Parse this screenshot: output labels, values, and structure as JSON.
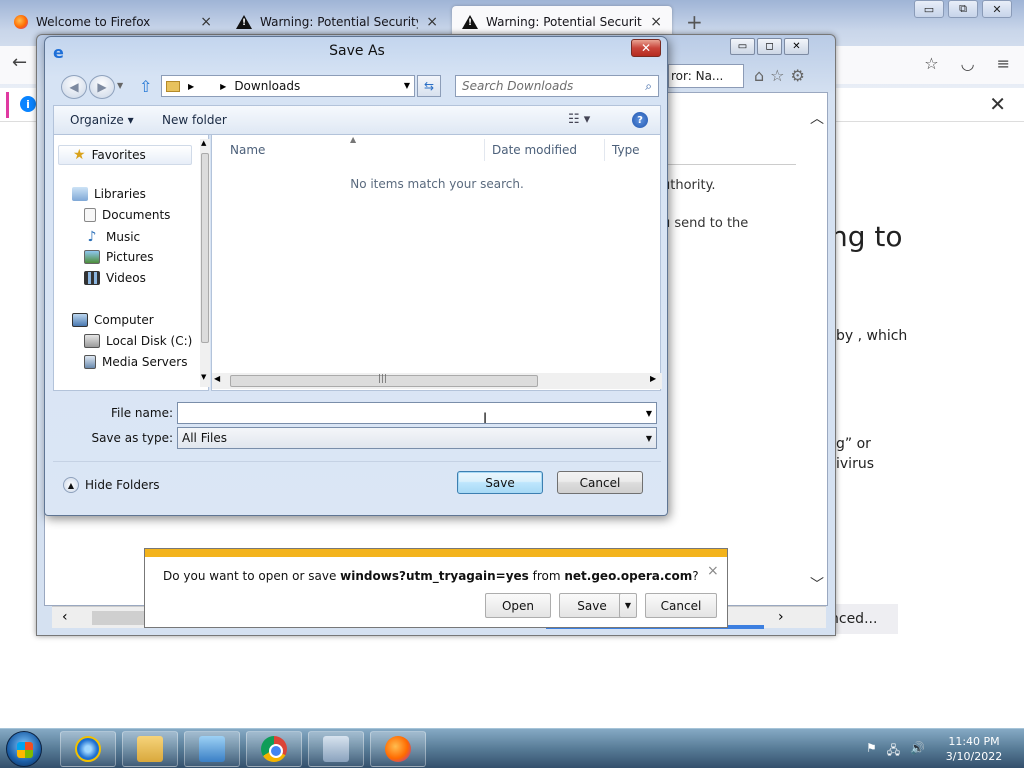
{
  "firefox": {
    "tabs": [
      {
        "label": "Welcome to Firefox"
      },
      {
        "label": "Warning: Potential Security Risk"
      },
      {
        "label": "Warning: Potential Security Risk"
      }
    ],
    "new_tab_glyph": "+",
    "close_glyph": "×",
    "nav_back_glyph": "←",
    "window_controls": [
      "▭",
      "⧉",
      "✕"
    ],
    "info_glyph": "i",
    "notif_close_glyph": "✕",
    "page_heading_fragment": "ng to",
    "page_text_fragment_1": "by , which",
    "page_text_fragment_2": "g” or",
    "page_text_fragment_3": "ivirus",
    "advanced_button_fragment": "nced..."
  },
  "ie_window": {
    "window_controls": [
      "▭",
      "◻",
      "✕"
    ],
    "address_fragment": "ror: Na...",
    "page_text_fragment_1": "uthority.",
    "page_text_fragment_2": "u send to the"
  },
  "save_as": {
    "title": "Save As",
    "close_glyph": "✕",
    "address": {
      "location": "Downloads"
    },
    "search": {
      "placeholder": "Search Downloads"
    },
    "toolbar": {
      "organize_label": "Organize ▾",
      "new_folder_label": "New folder",
      "help_glyph": "?"
    },
    "nav_pane": {
      "favorites": "Favorites",
      "libraries": "Libraries",
      "documents": "Documents",
      "music": "Music",
      "pictures": "Pictures",
      "videos": "Videos",
      "computer": "Computer",
      "local_disk": "Local Disk (C:)",
      "media_servers": "Media Servers"
    },
    "columns": {
      "name": "Name",
      "date_modified": "Date modified",
      "type": "Type"
    },
    "empty_message": "No items match your search.",
    "file_name_label": "File name:",
    "file_name_value": "",
    "save_as_type_label": "Save as type:",
    "save_as_type_value": "All Files",
    "hide_folders_label": "Hide Folders",
    "save_button": "Save",
    "cancel_button": "Cancel"
  },
  "notification": {
    "prefix": "Do you want to open or save ",
    "file": "windows?utm_tryagain=yes",
    "middle": " from ",
    "source": "net.geo.opera.com",
    "suffix": "?",
    "open_button": "Open",
    "save_button": "Save",
    "cancel_button": "Cancel",
    "close_glyph": "×"
  },
  "taskbar": {
    "clock_time": "11:40 PM",
    "clock_date": "3/10/2022"
  },
  "colors": {
    "accent_blue": "#3c7fb1",
    "notification_bar": "#f3b31c",
    "close_red": "#c9453a"
  }
}
